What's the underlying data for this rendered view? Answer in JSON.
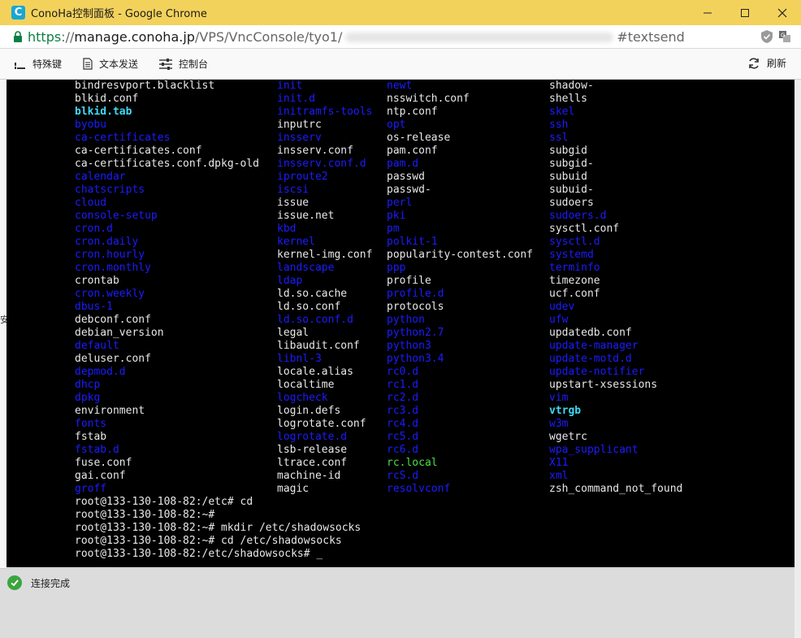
{
  "window": {
    "title": "ConoHa控制面板 - Google Chrome",
    "app_icon_letter": "C"
  },
  "address": {
    "https": "https",
    "sep": "://",
    "host": "manage.conoha.jp",
    "path": "/VPS/VncConsole/tyo1/",
    "hash": "#textsend"
  },
  "toolbar": {
    "special_keys": "特殊键",
    "send_text": "文本发送",
    "console": "控制台",
    "refresh": "刷新"
  },
  "terminal": {
    "rows": [
      [
        [
          "bindresvport.blacklist",
          "normal"
        ],
        [
          "init",
          "dir"
        ],
        [
          "newt",
          "dir"
        ],
        [
          "shadow-",
          "normal"
        ]
      ],
      [
        [
          "blkid.conf",
          "normal"
        ],
        [
          "init.d",
          "dir"
        ],
        [
          "nsswitch.conf",
          "normal"
        ],
        [
          "shells",
          "normal"
        ]
      ],
      [
        [
          "blkid.tab",
          "cyan"
        ],
        [
          "initramfs-tools",
          "dir"
        ],
        [
          "ntp.conf",
          "normal"
        ],
        [
          "skel",
          "dir"
        ]
      ],
      [
        [
          "byobu",
          "dir"
        ],
        [
          "inputrc",
          "normal"
        ],
        [
          "opt",
          "dir"
        ],
        [
          "ssh",
          "dir"
        ]
      ],
      [
        [
          "ca-certificates",
          "dir"
        ],
        [
          "insserv",
          "dir"
        ],
        [
          "os-release",
          "normal"
        ],
        [
          "ssl",
          "dir"
        ]
      ],
      [
        [
          "ca-certificates.conf",
          "normal"
        ],
        [
          "insserv.conf",
          "normal"
        ],
        [
          "pam.conf",
          "normal"
        ],
        [
          "subgid",
          "normal"
        ]
      ],
      [
        [
          "ca-certificates.conf.dpkg-old",
          "normal"
        ],
        [
          "insserv.conf.d",
          "dir"
        ],
        [
          "pam.d",
          "dir"
        ],
        [
          "subgid-",
          "normal"
        ]
      ],
      [
        [
          "calendar",
          "dir"
        ],
        [
          "iproute2",
          "dir"
        ],
        [
          "passwd",
          "normal"
        ],
        [
          "subuid",
          "normal"
        ]
      ],
      [
        [
          "chatscripts",
          "dir"
        ],
        [
          "iscsi",
          "dir"
        ],
        [
          "passwd-",
          "normal"
        ],
        [
          "subuid-",
          "normal"
        ]
      ],
      [
        [
          "cloud",
          "dir"
        ],
        [
          "issue",
          "normal"
        ],
        [
          "perl",
          "dir"
        ],
        [
          "sudoers",
          "normal"
        ]
      ],
      [
        [
          "console-setup",
          "dir"
        ],
        [
          "issue.net",
          "normal"
        ],
        [
          "pki",
          "dir"
        ],
        [
          "sudoers.d",
          "dir"
        ]
      ],
      [
        [
          "cron.d",
          "dir"
        ],
        [
          "kbd",
          "dir"
        ],
        [
          "pm",
          "dir"
        ],
        [
          "sysctl.conf",
          "normal"
        ]
      ],
      [
        [
          "cron.daily",
          "dir"
        ],
        [
          "kernel",
          "dir"
        ],
        [
          "polkit-1",
          "dir"
        ],
        [
          "sysctl.d",
          "dir"
        ]
      ],
      [
        [
          "cron.hourly",
          "dir"
        ],
        [
          "kernel-img.conf",
          "normal"
        ],
        [
          "popularity-contest.conf",
          "normal"
        ],
        [
          "systemd",
          "dir"
        ]
      ],
      [
        [
          "cron.monthly",
          "dir"
        ],
        [
          "landscape",
          "dir"
        ],
        [
          "ppp",
          "dir"
        ],
        [
          "terminfo",
          "dir"
        ]
      ],
      [
        [
          "crontab",
          "normal"
        ],
        [
          "ldap",
          "dir"
        ],
        [
          "profile",
          "normal"
        ],
        [
          "timezone",
          "normal"
        ]
      ],
      [
        [
          "cron.weekly",
          "dir"
        ],
        [
          "ld.so.cache",
          "normal"
        ],
        [
          "profile.d",
          "dir"
        ],
        [
          "ucf.conf",
          "normal"
        ]
      ],
      [
        [
          "dbus-1",
          "dir"
        ],
        [
          "ld.so.conf",
          "normal"
        ],
        [
          "protocols",
          "normal"
        ],
        [
          "udev",
          "dir"
        ]
      ],
      [
        [
          "debconf.conf",
          "normal"
        ],
        [
          "ld.so.conf.d",
          "dir"
        ],
        [
          "python",
          "dir"
        ],
        [
          "ufw",
          "dir"
        ]
      ],
      [
        [
          "debian_version",
          "normal"
        ],
        [
          "legal",
          "normal"
        ],
        [
          "python2.7",
          "dir"
        ],
        [
          "updatedb.conf",
          "normal"
        ]
      ],
      [
        [
          "default",
          "dir"
        ],
        [
          "libaudit.conf",
          "normal"
        ],
        [
          "python3",
          "dir"
        ],
        [
          "update-manager",
          "dir"
        ]
      ],
      [
        [
          "deluser.conf",
          "normal"
        ],
        [
          "libnl-3",
          "dir"
        ],
        [
          "python3.4",
          "dir"
        ],
        [
          "update-motd.d",
          "dir"
        ]
      ],
      [
        [
          "depmod.d",
          "dir"
        ],
        [
          "locale.alias",
          "normal"
        ],
        [
          "rc0.d",
          "dir"
        ],
        [
          "update-notifier",
          "dir"
        ]
      ],
      [
        [
          "dhcp",
          "dir"
        ],
        [
          "localtime",
          "normal"
        ],
        [
          "rc1.d",
          "dir"
        ],
        [
          "upstart-xsessions",
          "normal"
        ]
      ],
      [
        [
          "dpkg",
          "dir"
        ],
        [
          "logcheck",
          "dir"
        ],
        [
          "rc2.d",
          "dir"
        ],
        [
          "vim",
          "dir"
        ]
      ],
      [
        [
          "environment",
          "normal"
        ],
        [
          "login.defs",
          "normal"
        ],
        [
          "rc3.d",
          "dir"
        ],
        [
          "vtrgb",
          "cyan"
        ]
      ],
      [
        [
          "fonts",
          "dir"
        ],
        [
          "logrotate.conf",
          "normal"
        ],
        [
          "rc4.d",
          "dir"
        ],
        [
          "w3m",
          "dir"
        ]
      ],
      [
        [
          "fstab",
          "normal"
        ],
        [
          "logrotate.d",
          "dir"
        ],
        [
          "rc5.d",
          "dir"
        ],
        [
          "wgetrc",
          "normal"
        ]
      ],
      [
        [
          "fstab.d",
          "dir"
        ],
        [
          "lsb-release",
          "normal"
        ],
        [
          "rc6.d",
          "dir"
        ],
        [
          "wpa_supplicant",
          "dir"
        ]
      ],
      [
        [
          "fuse.conf",
          "normal"
        ],
        [
          "ltrace.conf",
          "normal"
        ],
        [
          "rc.local",
          "green"
        ],
        [
          "X11",
          "dir"
        ]
      ],
      [
        [
          "gai.conf",
          "normal"
        ],
        [
          "machine-id",
          "normal"
        ],
        [
          "rcS.d",
          "dir"
        ],
        [
          "xml",
          "dir"
        ]
      ],
      [
        [
          "groff",
          "dir"
        ],
        [
          "magic",
          "normal"
        ],
        [
          "resolvconf",
          "dir"
        ],
        [
          "zsh_command_not_found",
          "normal"
        ]
      ]
    ],
    "prompts": [
      "root@133-130-108-82:/etc# cd",
      "root@133-130-108-82:~#",
      "root@133-130-108-82:~# mkdir /etc/shadowsocks",
      "root@133-130-108-82:~# cd /etc/shadowsocks",
      "root@133-130-108-82:/etc/shadowsocks# _"
    ]
  },
  "status": {
    "message": "连接完成"
  },
  "colors": {
    "dir": "#1c1cff",
    "cyan": "#3fd9f5",
    "green": "#48e04a",
    "normal": "#e8e8e8"
  }
}
